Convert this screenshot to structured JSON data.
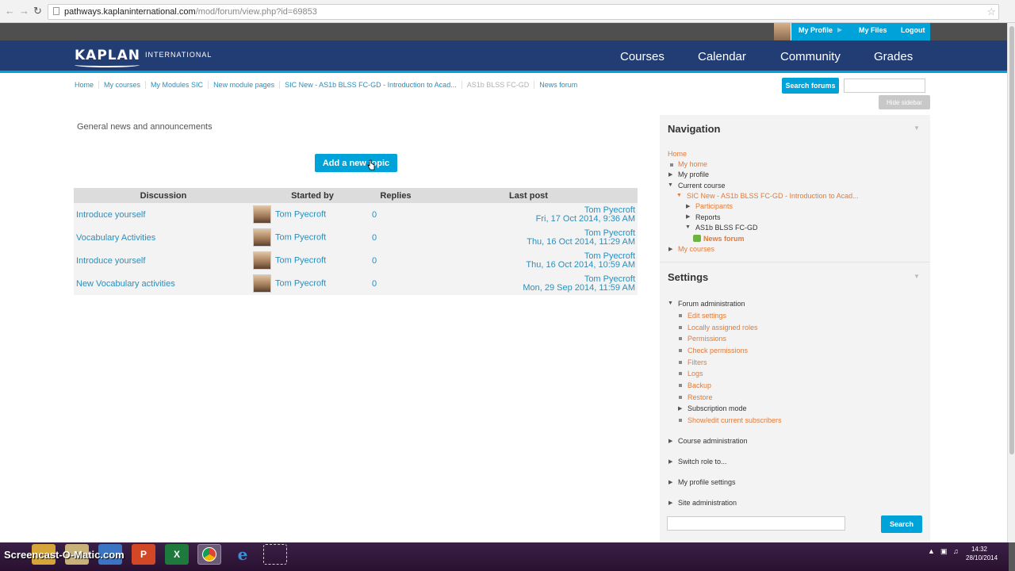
{
  "browser": {
    "url_domain": "pathways.kaplaninternational.com",
    "url_path": "/mod/forum/view.php?id=69853"
  },
  "utilnav": {
    "my_profile": "My Profile",
    "my_files": "My Files",
    "logout": "Logout"
  },
  "header": {
    "logo_main": "KAPLAN",
    "logo_sub": "INTERNATIONAL",
    "nav": [
      "Courses",
      "Calendar",
      "Community",
      "Grades"
    ]
  },
  "breadcrumb": [
    "Home",
    "My courses",
    "My Modules SIC",
    "New module pages",
    "SIC New - AS1b BLSS FC-GD - Introduction to Acad...",
    "AS1b BLSS FC-GD",
    "News forum"
  ],
  "search": {
    "button": "Search forums",
    "placeholder": ""
  },
  "hide_sidebar": "Hide sidebar",
  "main": {
    "intro": "General news and announcements",
    "add_topic": "Add a new topic",
    "columns": [
      "Discussion",
      "Started by",
      "Replies",
      "Last post"
    ],
    "rows": [
      {
        "discussion": "Introduce yourself",
        "started_by": "Tom Pyecroft",
        "replies": "0",
        "last_by": "Tom Pyecroft",
        "last_date": "Fri, 17 Oct 2014, 9:36 AM"
      },
      {
        "discussion": "Vocabulary Activities",
        "started_by": "Tom Pyecroft",
        "replies": "0",
        "last_by": "Tom Pyecroft",
        "last_date": "Thu, 16 Oct 2014, 11:29 AM"
      },
      {
        "discussion": "Introduce yourself",
        "started_by": "Tom Pyecroft",
        "replies": "0",
        "last_by": "Tom Pyecroft",
        "last_date": "Thu, 16 Oct 2014, 10:59 AM"
      },
      {
        "discussion": "New Vocabulary activities",
        "started_by": "Tom Pyecroft",
        "replies": "0",
        "last_by": "Tom Pyecroft",
        "last_date": "Mon, 29 Sep 2014, 11:59 AM"
      }
    ]
  },
  "navigation": {
    "title": "Navigation",
    "home": "Home",
    "my_home": "My home",
    "my_profile": "My profile",
    "current_course": "Current course",
    "course": "SIC New - AS1b BLSS FC-GD - Introduction to Acad...",
    "participants": "Participants",
    "reports": "Reports",
    "section": "AS1b BLSS FC-GD",
    "news_forum": "News forum",
    "my_courses": "My courses"
  },
  "settings": {
    "title": "Settings",
    "forum_admin": "Forum administration",
    "items": [
      "Edit settings",
      "Locally assigned roles",
      "Permissions",
      "Check permissions",
      "Filters",
      "Logs",
      "Backup",
      "Restore"
    ],
    "subscription": "Subscription mode",
    "subscribers": "Show/edit current subscribers",
    "course_admin": "Course administration",
    "switch_role": "Switch role to...",
    "profile_settings": "My profile settings",
    "site_admin": "Site administration",
    "search_button": "Search"
  },
  "taskbar": {
    "watermark": "Screencast-O-Matic.com",
    "time": "14:32",
    "date": "28/10/2014"
  },
  "colors": {
    "header": "#223d73",
    "accent": "#00a3d9",
    "link": "#2a8fbd",
    "nav_link": "#e07b3a"
  }
}
